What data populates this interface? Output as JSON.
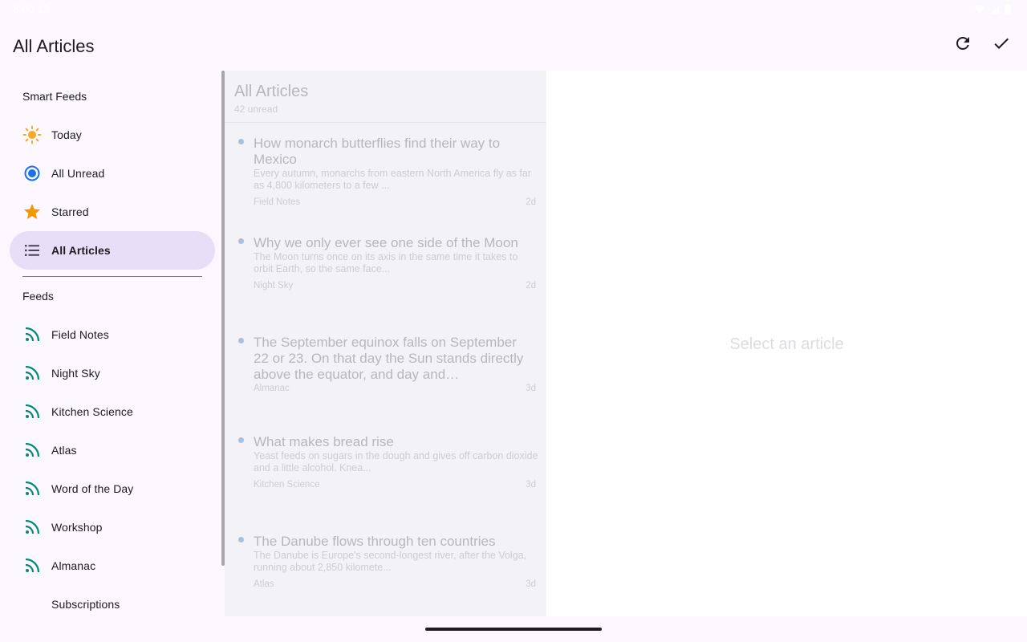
{
  "status": {
    "time": "8:00 13"
  },
  "app_bar": {
    "title": "All Articles",
    "actions": [
      {
        "name": "refresh",
        "icon": "refresh-icon"
      },
      {
        "name": "mark-all-read",
        "icon": "check-icon"
      }
    ]
  },
  "sidebar": {
    "smart_feeds_label": "Smart Feeds",
    "smart_feeds": [
      {
        "label": "Today",
        "icon": "sun-icon"
      },
      {
        "label": "All Unread",
        "icon": "radio-dot-icon"
      },
      {
        "label": "Starred",
        "icon": "star-icon"
      },
      {
        "label": "All Articles",
        "icon": "list-icon",
        "selected": true
      }
    ],
    "feeds_label": "Feeds",
    "feeds": [
      {
        "label": "Field Notes",
        "icon": "rss-icon"
      },
      {
        "label": "Night Sky",
        "icon": "rss-icon"
      },
      {
        "label": "Kitchen Science",
        "icon": "rss-icon"
      },
      {
        "label": "Atlas",
        "icon": "rss-icon"
      },
      {
        "label": "Word of the Day",
        "icon": "rss-icon"
      },
      {
        "label": "Workshop",
        "icon": "rss-icon"
      },
      {
        "label": "Almanac",
        "icon": "rss-icon"
      }
    ],
    "subscriptions_label": "Subscriptions"
  },
  "list": {
    "title": "All Articles",
    "unread_count": "42 unread",
    "articles": [
      {
        "title": "How monarch butterflies find their way to Mexico",
        "summary": "Every autumn, monarchs from eastern North America fly as far as 4,800 kilometers to a few ...",
        "feed": "Field Notes",
        "age": "2d"
      },
      {
        "title": "Why we only ever see one side of the Moon",
        "summary": "The Moon turns once on its axis in the same time it takes to orbit Earth, so the same face...",
        "feed": "Night Sky",
        "age": "2d"
      },
      {
        "title": "The September equinox falls on September 22 or 23. On that day the Sun stands directly above the equator, and day and…",
        "summary": "",
        "feed": "Almanac",
        "age": "3d"
      },
      {
        "title": "What makes bread rise",
        "summary": "Yeast feeds on sugars in the dough and gives off carbon dioxide and a little alcohol. Knea...",
        "feed": "Kitchen Science",
        "age": "3d"
      },
      {
        "title": "The Danube flows through ten countries",
        "summary": "The Danube is Europe's second-longest river, after the Volga, running about 2,850 kilomete...",
        "feed": "Atlas",
        "age": "3d"
      }
    ]
  },
  "detail": {
    "empty_text": "Select an article"
  },
  "colors": {
    "accent": "#6750a4",
    "selected_bg": "#e8def8",
    "rss": "#00897b",
    "sun": "#f9a825",
    "radio": "#1a73e8",
    "star": "#f29900"
  }
}
